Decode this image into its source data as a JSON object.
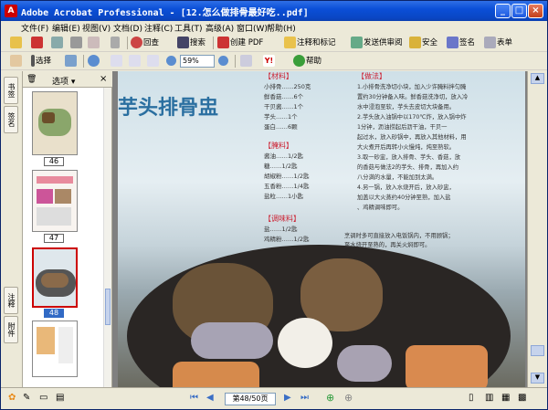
{
  "window": {
    "title": "Adobe Acrobat Professional - [12.怎么做排骨最好吃..pdf]",
    "app_icon": "acrobat-icon"
  },
  "menu": [
    "文件(F)",
    "编辑(E)",
    "视图(V)",
    "文档(D)",
    "注释(C)",
    "工具(T)",
    "高级(A)",
    "窗口(W)",
    "帮助(H)"
  ],
  "toolbar1": {
    "create_pdf": "创建 PDF",
    "review": "注释和标记",
    "send": "发送供审阅",
    "secure": "安全",
    "sign": "签名",
    "forms": "表单",
    "search": "搜索",
    "findtext": "回查"
  },
  "toolbar2": {
    "select": "选择",
    "snapshot": "抓图",
    "zoom": "59%",
    "help": "帮助"
  },
  "panel": {
    "options": "选项",
    "pages": [
      {
        "num": "46"
      },
      {
        "num": "47"
      },
      {
        "num": "48"
      }
    ]
  },
  "nav_tabs": [
    "书签",
    "签名",
    "注释",
    "附件"
  ],
  "document": {
    "title": "芋头排骨盅",
    "section_ingredients": "【材料】",
    "ingredients": [
      "小排骨……250克",
      "鲜香菇……6个",
      "干贝酱……1个",
      "芋头……1个",
      "蛋白……6颗"
    ],
    "section_marinade": "【腌料】",
    "marinade": [
      "酱油……1/2匙",
      "糖……1/2匙",
      "胡椒粉……1/2匙",
      "五香粉……1/4匙",
      "盐粒……1小匙"
    ],
    "section_seasoning": "【调味料】",
    "seasoning": [
      "盐……1/2匙",
      "鸡精粉……1/2匙"
    ],
    "section_method": "【做法】",
    "method": [
      "1.小排骨洗净切小块，加入少许腌料拌匀腌",
      "置约30分钟备入味。鲜香菇洗净切，放入冷",
      "水中浸泡至软，芋头去皮切大块备用。",
      "2.芋头放入油锅中以170℃炸，放入锅中炸",
      "1分钟，沥油捞起后沥干油，干贝一",
      "起过水，放入砂锅中，再放入其他材料，用",
      "大火煮开后再转小火慢炖，炖至熟软。",
      "3.取一砂盅，放入排骨、芋头、香菇，放",
      "的香菇与做法2的芋头、排骨，再加入约",
      "八分满的水量，不能加到太满。",
      "4.另一锅，放入水烧开后，放入砂盅，",
      "加盖以大火蒸约40分钟至熟，加入盐",
      "、鸡精调味即可。"
    ],
    "tip": "烹调时多可直接放入电饭锅内，不用顾锅；",
    "tip2": "至水烧开至熟的，再关火焖即可。"
  },
  "status": {
    "page_display": "第48/50页"
  }
}
